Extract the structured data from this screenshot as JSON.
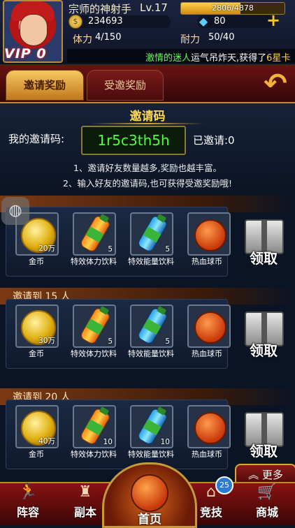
{
  "header": {
    "player_name": "宗师的神射手",
    "level": "Lv.17",
    "exp_text": "2806/4878",
    "exp_fraction": 0.575,
    "coins": "234693",
    "gems": "80",
    "stamina_label": "体力",
    "stamina_value": "4/150",
    "endurance_label": "耐力",
    "endurance_value": "50/40",
    "vip": "VIP 0",
    "marquee_name": "激情的迷人",
    "marquee_text": "运气吊炸天,获得了",
    "marquee_tail": "6星卡"
  },
  "tabs": {
    "invite_reward": "邀请奖励",
    "invited_reward": "受邀奖励"
  },
  "invite": {
    "title": "邀请码",
    "my_code_label": "我的邀请码:",
    "code": "1r5c3th5h",
    "invited_label": "已邀请:0",
    "tip1": "1、邀请好友数量越多,奖励也越丰富。",
    "tip2": "2、输入好友的邀请码,也可获得受邀奖励哦!"
  },
  "tiers": [
    {
      "title": "",
      "items": [
        {
          "name": "金币",
          "qty": "20万",
          "icon": "coin-icon"
        },
        {
          "name": "特效体力饮料",
          "qty": "5",
          "icon": "orange-drink-icon"
        },
        {
          "name": "特效能量饮料",
          "qty": "5",
          "icon": "blue-drink-icon"
        },
        {
          "name": "热血球币",
          "qty": "",
          "icon": "basketball-coin-icon"
        }
      ],
      "collect": "领取"
    },
    {
      "title": "邀请到 15 人",
      "items": [
        {
          "name": "金币",
          "qty": "30万",
          "icon": "coin-icon"
        },
        {
          "name": "特效体力饮料",
          "qty": "5",
          "icon": "orange-drink-icon"
        },
        {
          "name": "特效能量饮料",
          "qty": "5",
          "icon": "blue-drink-icon"
        },
        {
          "name": "热血球币",
          "qty": "",
          "icon": "basketball-coin-icon"
        }
      ],
      "collect": "领取"
    },
    {
      "title": "邀请到 20 人",
      "items": [
        {
          "name": "金币",
          "qty": "40万",
          "icon": "coin-icon"
        },
        {
          "name": "特效体力饮料",
          "qty": "10",
          "icon": "orange-drink-icon"
        },
        {
          "name": "特效能量饮料",
          "qty": "10",
          "icon": "blue-drink-icon"
        },
        {
          "name": "热血球币",
          "qty": "",
          "icon": "basketball-coin-icon"
        }
      ],
      "collect": "领取"
    }
  ],
  "nav": {
    "more": "更多",
    "lineup": "阵容",
    "dungeon": "副本",
    "home": "首页",
    "compete": "竞技",
    "shop": "商城",
    "compete_badge": "25"
  }
}
